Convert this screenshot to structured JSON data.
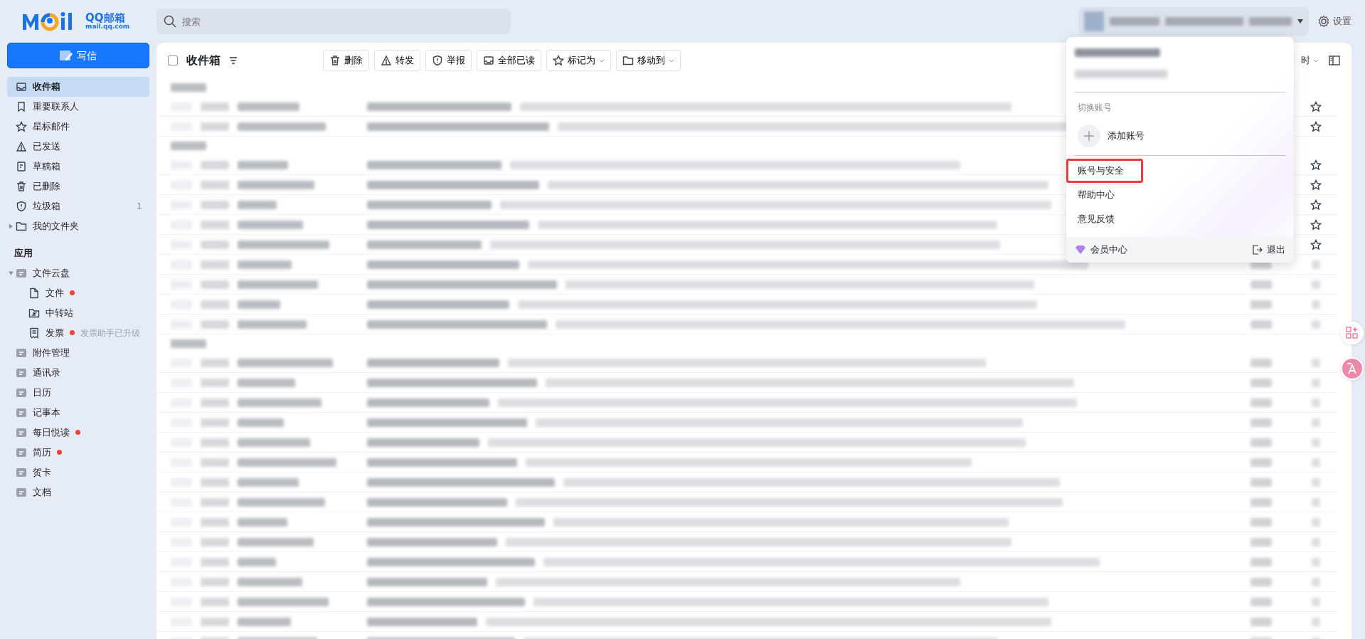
{
  "logo": {
    "brand": "QQ邮箱",
    "domain": "mail.qq.com"
  },
  "search": {
    "placeholder": "搜索"
  },
  "compose": {
    "label": "写信"
  },
  "folders": [
    {
      "label": "收件箱",
      "selected": true
    },
    {
      "label": "重要联系人",
      "selected": false
    },
    {
      "label": "星标邮件",
      "selected": false
    },
    {
      "label": "已发送",
      "selected": false
    },
    {
      "label": "草稿箱",
      "selected": false
    },
    {
      "label": "已删除",
      "selected": false
    },
    {
      "label": "垃圾箱",
      "selected": false,
      "count": "1"
    },
    {
      "label": "我的文件夹",
      "selected": false,
      "expanded": false
    }
  ],
  "apps": {
    "title": "应用",
    "items": [
      {
        "label": "文件云盘",
        "expanded": true,
        "dot": false,
        "children": [
          {
            "label": "文件",
            "dot": true
          },
          {
            "label": "中转站",
            "dot": false
          },
          {
            "label": "发票",
            "dot": true,
            "note": "发票助手已升级"
          }
        ]
      },
      {
        "label": "附件管理",
        "dot": false
      },
      {
        "label": "通讯录",
        "dot": false
      },
      {
        "label": "日历",
        "dot": false
      },
      {
        "label": "记事本",
        "dot": false
      },
      {
        "label": "每日悦读",
        "dot": true
      },
      {
        "label": "简历",
        "dot": true
      },
      {
        "label": "贺卡",
        "dot": false
      },
      {
        "label": "文档",
        "dot": false
      }
    ]
  },
  "mailbox": {
    "title": "收件箱",
    "select_all": false,
    "actions": [
      {
        "label": "删除",
        "menu": false
      },
      {
        "label": "转发",
        "menu": false
      },
      {
        "label": "举报",
        "menu": false
      },
      {
        "label": "全部已读",
        "menu": false
      },
      {
        "label": "标记为",
        "menu": true
      },
      {
        "label": "移动到",
        "menu": true
      }
    ],
    "sort_label": "时"
  },
  "mail_groups": [
    {
      "rows": [
        {
          "kind": "star"
        },
        {
          "kind": "star"
        }
      ]
    },
    {
      "rows": [
        {
          "kind": "star"
        },
        {
          "kind": "star"
        },
        {
          "kind": "star"
        },
        {
          "kind": "star"
        },
        {
          "kind": "star"
        },
        {
          "kind": "plain"
        },
        {
          "kind": "plain"
        },
        {
          "kind": "plain"
        },
        {
          "kind": "plain"
        }
      ]
    },
    {
      "rows": [
        {
          "kind": "plain"
        },
        {
          "kind": "plain"
        },
        {
          "kind": "plain"
        },
        {
          "kind": "plain"
        },
        {
          "kind": "plain"
        },
        {
          "kind": "plain"
        },
        {
          "kind": "plain"
        },
        {
          "kind": "plain"
        },
        {
          "kind": "plain"
        },
        {
          "kind": "plain"
        },
        {
          "kind": "plain"
        },
        {
          "kind": "plain"
        },
        {
          "kind": "plain"
        },
        {
          "kind": "plain"
        },
        {
          "kind": "plain"
        }
      ]
    }
  ],
  "account": {
    "blurred": true
  },
  "settings": {
    "label": "设置"
  },
  "account_menu": {
    "switch_title": "切换账号",
    "add_label": "添加账号",
    "items": [
      {
        "label": "账号与安全",
        "highlighted": true
      },
      {
        "label": "帮助中心",
        "highlighted": false
      },
      {
        "label": "意见反馈",
        "highlighted": false
      }
    ],
    "vip_label": "会员中心",
    "logout_label": "退出"
  }
}
